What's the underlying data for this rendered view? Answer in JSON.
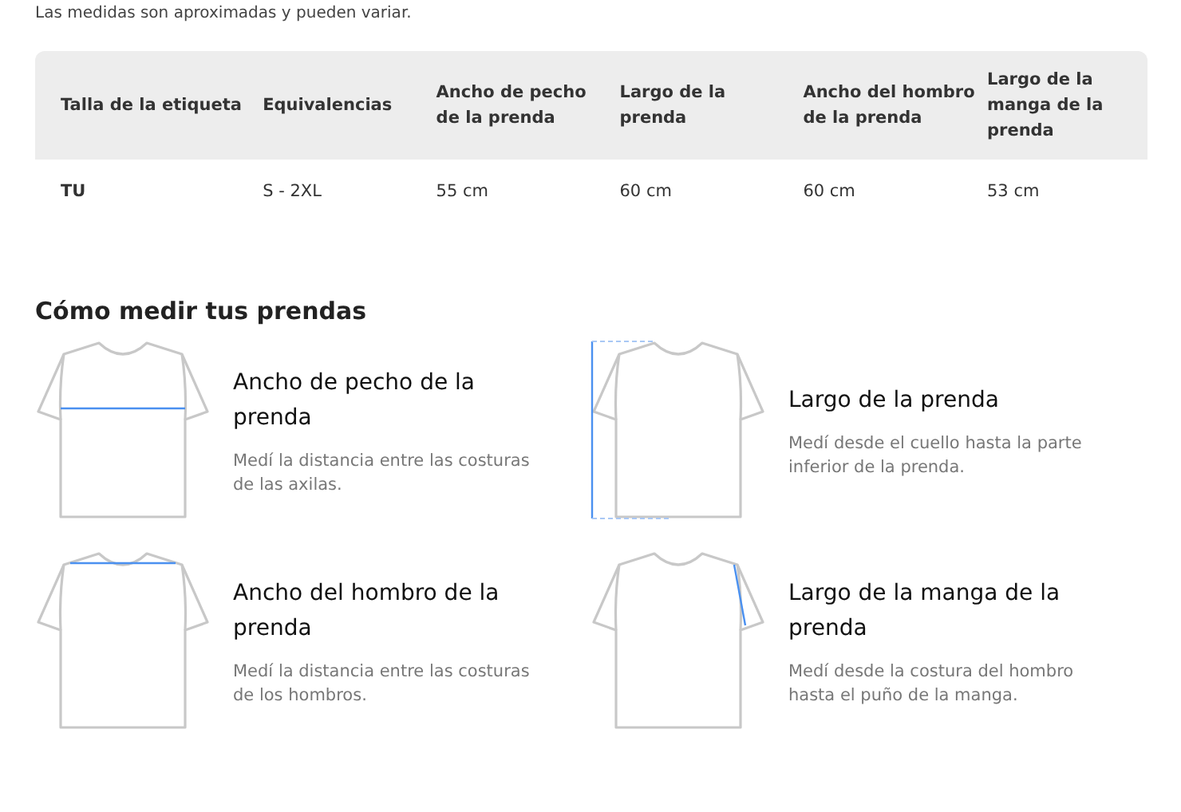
{
  "note": "Las medidas son aproximadas y pueden variar.",
  "table": {
    "columns": [
      "Talla de la etiqueta",
      "Equivalencias",
      "Ancho de pecho de la prenda",
      "Largo de la prenda",
      "Ancho del hombro de la prenda",
      "Largo de la manga de la prenda"
    ],
    "rows": [
      [
        "TU",
        "S - 2XL",
        "55 cm",
        "60 cm",
        "60 cm",
        "53 cm"
      ]
    ]
  },
  "guide": {
    "title": "Cómo medir tus prendas",
    "items": [
      {
        "kind": "chest",
        "title": "Ancho de pecho de la prenda",
        "text": "Medí la distancia entre las costuras de las axilas."
      },
      {
        "kind": "length",
        "title": "Largo de la prenda",
        "text": "Medí desde el cuello hasta la parte inferior de la prenda."
      },
      {
        "kind": "shoulder",
        "title": "Ancho del hombro de la prenda",
        "text": "Medí la distancia entre las costuras de los hombros."
      },
      {
        "kind": "sleeve",
        "title": "Largo de la manga de la prenda",
        "text": "Medí desde la costura del hombro hasta el puño de la manga."
      }
    ]
  }
}
